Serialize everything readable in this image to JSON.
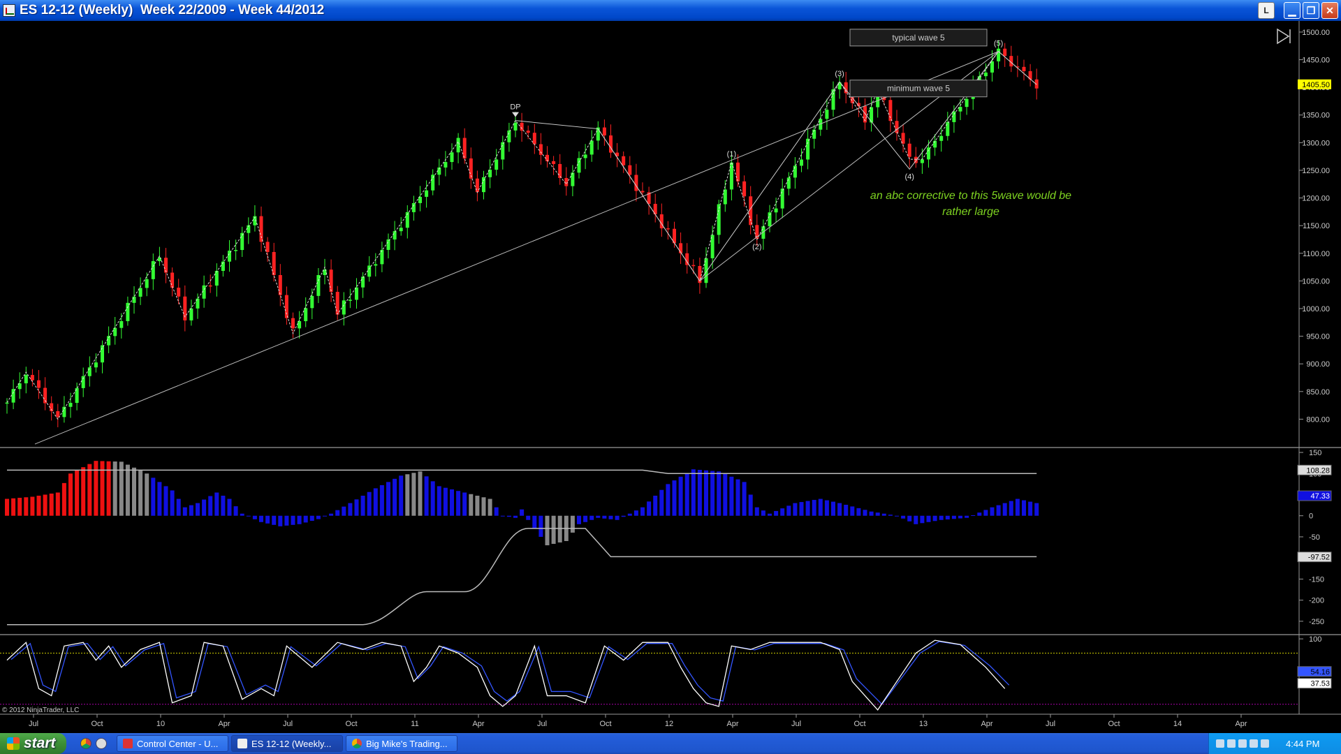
{
  "window": {
    "title": "ES 12-12 (Weekly)  Week 22/2009 - Week 44/2012",
    "btn_l": "L",
    "btn_min": "▁",
    "btn_max": "❐",
    "btn_close": "✕"
  },
  "taskbar": {
    "start": "start",
    "tasks": [
      "Control Center - U...",
      "ES 12-12 (Weekly...",
      "Big Mike's Trading..."
    ],
    "clock": "4:44 PM"
  },
  "chart_data": {
    "type": "candlestick",
    "instrument": "ES 12-12 (Weekly)",
    "copyright": "© 2012 NinjaTrader, LLC",
    "x_labels": [
      "Jul",
      "Oct",
      "10",
      "Apr",
      "Jul",
      "Oct",
      "11",
      "Apr",
      "Jul",
      "Oct",
      "12",
      "Apr",
      "Jul",
      "Oct",
      "13",
      "Apr",
      "Jul",
      "Oct",
      "14",
      "Apr"
    ],
    "price_panel": {
      "ylim": [
        750,
        1510
      ],
      "yticks": [
        800,
        850,
        900,
        950,
        1000,
        1050,
        1100,
        1150,
        1200,
        1250,
        1300,
        1350,
        1400,
        1450,
        1500
      ],
      "last_price": "1405.50",
      "swings": [
        {
          "i": 0,
          "p": 830
        },
        {
          "i": 3,
          "p": 885
        },
        {
          "i": 8,
          "p": 800
        },
        {
          "i": 24,
          "p": 1095
        },
        {
          "i": 28,
          "p": 985
        },
        {
          "i": 39,
          "p": 1165
        },
        {
          "i": 45,
          "p": 955
        },
        {
          "i": 50,
          "p": 1075
        },
        {
          "i": 52,
          "p": 990
        },
        {
          "i": 71,
          "p": 1302
        },
        {
          "i": 74,
          "p": 1210
        },
        {
          "i": 80,
          "p": 1340
        },
        {
          "i": 88,
          "p": 1225
        },
        {
          "i": 93,
          "p": 1325
        },
        {
          "i": 109,
          "p": 1050
        },
        {
          "i": 114,
          "p": 1265
        },
        {
          "i": 118,
          "p": 1125
        },
        {
          "i": 131,
          "p": 1410
        },
        {
          "i": 135,
          "p": 1340
        },
        {
          "i": 137,
          "p": 1395
        },
        {
          "i": 142,
          "p": 1270
        },
        {
          "i": 144,
          "p": 1270
        },
        {
          "i": 156,
          "p": 1465
        },
        {
          "i": 162,
          "p": 1405
        }
      ],
      "wave_labels": [
        {
          "text": "DP",
          "i": 80,
          "p": 1340
        },
        {
          "text": "(1)",
          "i": 114,
          "p": 1265
        },
        {
          "text": "(2)",
          "i": 118,
          "p": 1125
        },
        {
          "text": "(3)",
          "i": 131,
          "p": 1410
        },
        {
          "text": "(4)",
          "i": 142,
          "p": 1252
        },
        {
          "text": "(5)",
          "i": 156,
          "p": 1465
        }
      ],
      "boxes": [
        {
          "label": "typical wave 5",
          "p": 1490
        },
        {
          "label": "minimum wave 5",
          "p": 1398
        }
      ],
      "annotation": [
        "an abc corrective to this 5wave would be",
        "rather large"
      ]
    },
    "histogram_panel": {
      "ylim": [
        -280,
        160
      ],
      "yticks": [
        150,
        100,
        50,
        0,
        -50,
        -100,
        -150,
        -200,
        -250
      ],
      "readouts": [
        "108.28",
        "47.33",
        "-97.52"
      ],
      "upper_line": 108.28,
      "lower_line_end": -97.52
    },
    "stoch_panel": {
      "ylim": [
        -5,
        105
      ],
      "yticks": [
        100
      ],
      "readouts": [
        "54.16",
        "37.53"
      ],
      "upper_level": 80,
      "lower_level": 8
    }
  }
}
